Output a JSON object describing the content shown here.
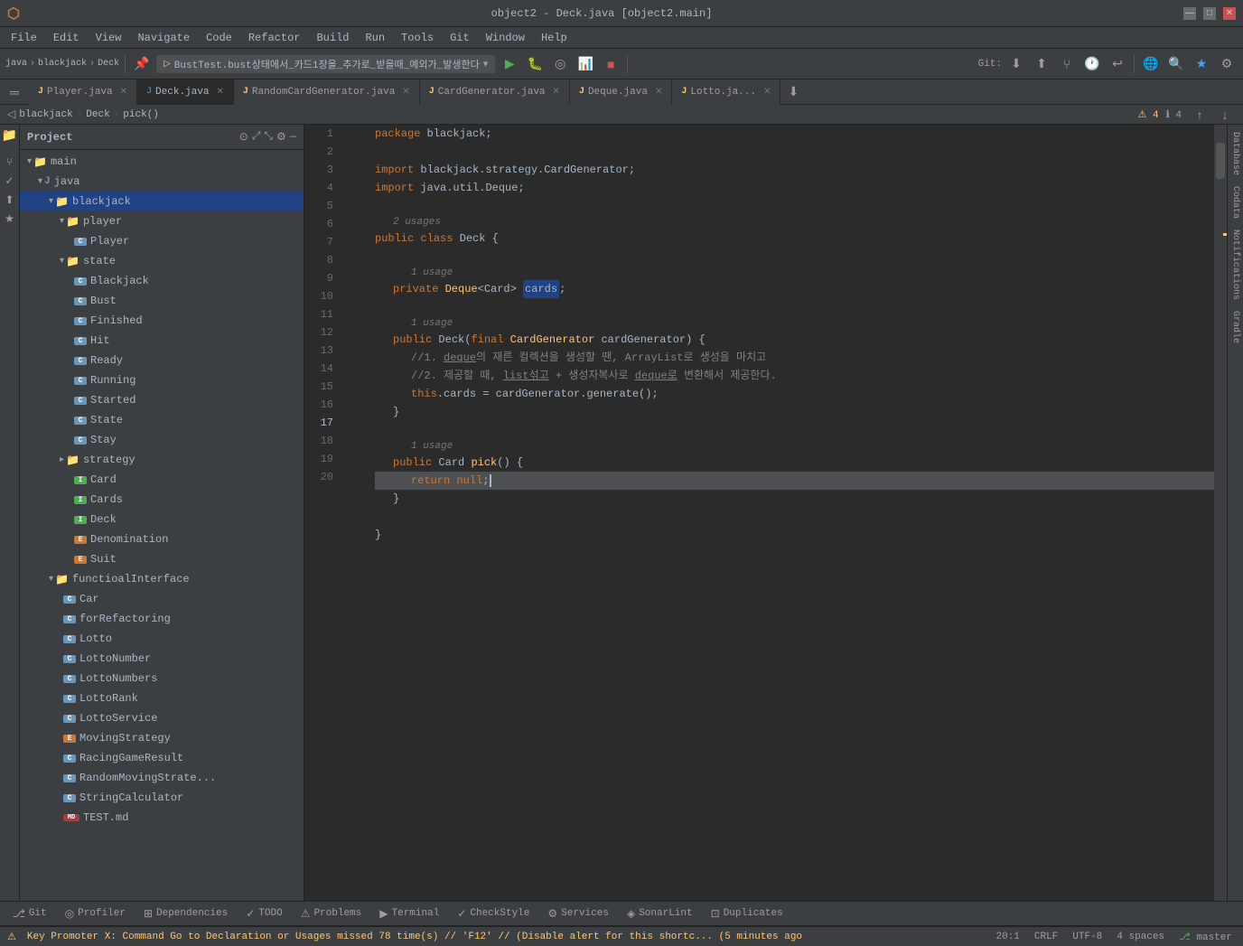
{
  "titleBar": {
    "title": "object2 - Deck.java [object2.main]",
    "minimize": "—",
    "maximize": "□",
    "close": "✕"
  },
  "menuBar": {
    "items": [
      "File",
      "Edit",
      "View",
      "Navigate",
      "Code",
      "Refactor",
      "Build",
      "Run",
      "Tools",
      "Git",
      "Window",
      "Help"
    ]
  },
  "toolbar": {
    "path": "BustTest.bust상태에서_카드1장을_추가로_받을때_예외가_발생한다",
    "gitLabel": "Git:"
  },
  "tabs": [
    {
      "label": "Player.java",
      "type": "java",
      "active": false
    },
    {
      "label": "Deck.java",
      "type": "java",
      "active": true
    },
    {
      "label": "RandomCardGenerator.java",
      "type": "java",
      "active": false
    },
    {
      "label": "CardGenerator.java",
      "type": "java",
      "active": false
    },
    {
      "label": "Deque.java",
      "type": "java",
      "active": false
    },
    {
      "label": "Lotto.ja...",
      "type": "java",
      "active": false
    }
  ],
  "breadcrumb": {
    "parts": [
      "blackjack",
      "Deck",
      "pick()"
    ]
  },
  "projectPanel": {
    "title": "Project",
    "tree": [
      {
        "level": 0,
        "type": "folder",
        "label": "main",
        "expanded": true
      },
      {
        "level": 1,
        "type": "folder",
        "label": "java",
        "expanded": true
      },
      {
        "level": 2,
        "type": "folder",
        "label": "blackjack",
        "expanded": true,
        "selected": true
      },
      {
        "level": 3,
        "type": "folder",
        "label": "player",
        "expanded": true
      },
      {
        "level": 4,
        "type": "class",
        "label": "Player"
      },
      {
        "level": 3,
        "type": "folder",
        "label": "state",
        "expanded": true
      },
      {
        "level": 4,
        "type": "class",
        "label": "Blackjack"
      },
      {
        "level": 4,
        "type": "class",
        "label": "Bust"
      },
      {
        "level": 4,
        "type": "class",
        "label": "Finished"
      },
      {
        "level": 4,
        "type": "class",
        "label": "Hit"
      },
      {
        "level": 4,
        "type": "class",
        "label": "Ready"
      },
      {
        "level": 4,
        "type": "class",
        "label": "Running"
      },
      {
        "level": 4,
        "type": "class",
        "label": "Started"
      },
      {
        "level": 4,
        "type": "class",
        "label": "State"
      },
      {
        "level": 4,
        "type": "class",
        "label": "Stay"
      },
      {
        "level": 3,
        "type": "folder",
        "label": "strategy",
        "expanded": false
      },
      {
        "level": 4,
        "type": "interface",
        "label": "Card"
      },
      {
        "level": 4,
        "type": "interface",
        "label": "Cards"
      },
      {
        "level": 4,
        "type": "interface",
        "label": "Deck"
      },
      {
        "level": 4,
        "type": "enum",
        "label": "Denomination"
      },
      {
        "level": 4,
        "type": "enum",
        "label": "Suit"
      },
      {
        "level": 2,
        "type": "folder",
        "label": "functioalInterface",
        "expanded": true
      },
      {
        "level": 3,
        "type": "class",
        "label": "Car"
      },
      {
        "level": 3,
        "type": "class",
        "label": "forRefactoring"
      },
      {
        "level": 3,
        "type": "class",
        "label": "Lotto"
      },
      {
        "level": 3,
        "type": "class",
        "label": "LottoNumber"
      },
      {
        "level": 3,
        "type": "class",
        "label": "LottoNumbers"
      },
      {
        "level": 3,
        "type": "class",
        "label": "LottoRank"
      },
      {
        "level": 3,
        "type": "class",
        "label": "LottoService"
      },
      {
        "level": 3,
        "type": "enum",
        "label": "MovingStrategy"
      },
      {
        "level": 3,
        "type": "class",
        "label": "RacingGameResult"
      },
      {
        "level": 3,
        "type": "class",
        "label": "RandomMovingStrate..."
      },
      {
        "level": 3,
        "type": "class",
        "label": "StringCalculator"
      },
      {
        "level": 3,
        "type": "file",
        "label": "TEST.md"
      }
    ]
  },
  "codeLines": [
    {
      "num": 1,
      "content": "package blackjack;",
      "type": "normal"
    },
    {
      "num": 2,
      "content": "",
      "type": "normal"
    },
    {
      "num": 3,
      "content": "import blackjack.strategy.CardGenerator;",
      "type": "normal"
    },
    {
      "num": 4,
      "content": "import java.util.Deque;",
      "type": "normal"
    },
    {
      "num": 5,
      "content": "",
      "type": "normal"
    },
    {
      "num": 6,
      "content": "public class Deck {",
      "type": "normal"
    },
    {
      "num": 7,
      "content": "",
      "type": "normal"
    },
    {
      "num": 8,
      "content": "    private Deque<Card> cards;",
      "type": "normal"
    },
    {
      "num": 9,
      "content": "",
      "type": "normal"
    },
    {
      "num": 10,
      "content": "    public Deck(final CardGenerator cardGenerator) {",
      "type": "normal"
    },
    {
      "num": 11,
      "content": "        //1. deque의 재른 컬렉션을 생성할 땐, ArrayList로 생성을 마치고",
      "type": "comment"
    },
    {
      "num": 12,
      "content": "        //2. 제공할 때, list섞고 + 생성자복사로 deque로 변환해서 제공한다.",
      "type": "comment"
    },
    {
      "num": 13,
      "content": "        this.cards = cardGenerator.generate();",
      "type": "normal"
    },
    {
      "num": 14,
      "content": "    }",
      "type": "normal"
    },
    {
      "num": 15,
      "content": "",
      "type": "normal"
    },
    {
      "num": 16,
      "content": "    public Card pick() {",
      "type": "normal"
    },
    {
      "num": 17,
      "content": "        return null;",
      "type": "normal",
      "cursor": true
    },
    {
      "num": 18,
      "content": "    }",
      "type": "normal"
    },
    {
      "num": 19,
      "content": "",
      "type": "normal"
    },
    {
      "num": 20,
      "content": "}",
      "type": "normal"
    }
  ],
  "bottomTabs": [
    {
      "label": "Git",
      "icon": "⎇"
    },
    {
      "label": "Profiler",
      "icon": "◎"
    },
    {
      "label": "Dependencies",
      "icon": "⊞"
    },
    {
      "label": "TODO",
      "icon": "✓"
    },
    {
      "label": "Problems",
      "icon": "⚠"
    },
    {
      "label": "Terminal",
      "icon": "▶"
    },
    {
      "label": "CheckStyle",
      "icon": "✓"
    },
    {
      "label": "Services",
      "icon": "⚙"
    },
    {
      "label": "SonarLint",
      "icon": "◈"
    },
    {
      "label": "Duplicates",
      "icon": "⊡"
    }
  ],
  "statusBar": {
    "warning": "Key Promoter X: Command Go to Declaration or Usages missed 78 time(s) // 'F12' // (Disable alert for this shortc... (5 minutes ago",
    "position": "20:1",
    "lineEnding": "CRLF",
    "encoding": "UTF-8",
    "indent": "4 spaces",
    "branch": "master"
  },
  "rightPanel": {
    "items": [
      "Database",
      "Codata",
      "Notifications",
      "Gradle"
    ]
  }
}
